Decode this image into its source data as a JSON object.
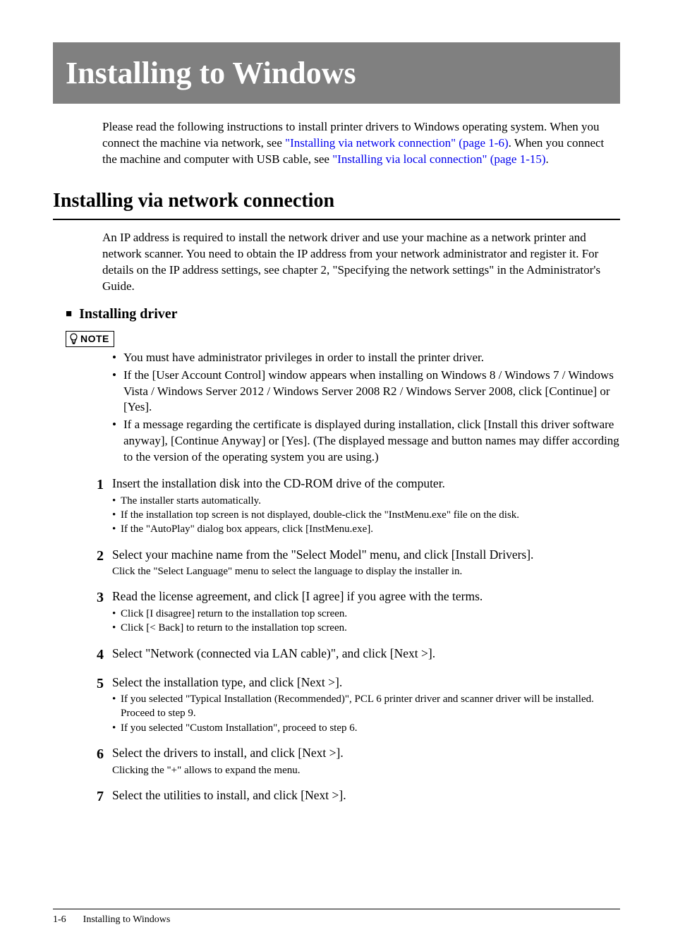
{
  "chapter": {
    "title": "Installing to Windows"
  },
  "intro": {
    "pre": "Please read the following instructions to install printer drivers to Windows operating system.  When you connect the machine via network, see ",
    "link1": "\"Installing via network connection\" (page 1-6)",
    "mid": ".  When you connect the machine and computer with USB cable, see ",
    "link2": "\"Installing via local connection\" (page 1-15)",
    "post": "."
  },
  "section": {
    "title": "Installing via network connection",
    "body": "An IP address is required to install the network driver and use your machine as a network printer and network scanner.  You need to obtain the IP address from your network administrator and register it.  For details on the IP address settings, see chapter 2, \"Specifying the network settings\" in the Administrator's Guide."
  },
  "subsection": {
    "bullet": "■",
    "title": "Installing driver"
  },
  "note": {
    "label": "NOTE",
    "items": [
      "You must have administrator privileges in order to install the printer driver.",
      "If the [User Account Control] window appears when installing on Windows 8 / Windows 7 / Windows Vista / Windows Server 2012 / Windows Server 2008 R2 / Windows Server 2008, click [Continue] or [Yes].",
      "If a message regarding the certificate is displayed during installation, click [Install this driver software anyway], [Continue Anyway] or [Yes]. (The displayed message and button names may differ according to the version of the operating system you are using.)"
    ]
  },
  "steps": [
    {
      "num": "1",
      "main": "Insert the installation disk into the CD-ROM drive of the computer.",
      "subs": [
        "The installer starts automatically.",
        "If the installation top screen is not displayed, double-click the \"InstMenu.exe\" file on the disk.",
        "If the \"AutoPlay\" dialog box appears, click [InstMenu.exe]."
      ]
    },
    {
      "num": "2",
      "main": "Select your machine name from the \"Select Model\" menu, and click [Install Drivers].",
      "plain_sub": "Click the \"Select Language\" menu to select the language to display the installer in."
    },
    {
      "num": "3",
      "main": "Read the license agreement, and click [I agree] if you agree with the terms.",
      "subs": [
        "Click [I disagree] return to the installation top screen.",
        "Click [< Back] to return to the installation top screen."
      ]
    },
    {
      "num": "4",
      "main": "Select \"Network (connected via LAN cable)\", and click [Next >]."
    },
    {
      "num": "5",
      "main": "Select the installation type, and click [Next >].",
      "subs": [
        "If you selected \"Typical Installation (Recommended)\", PCL 6 printer driver and scanner driver will be installed.  Proceed to step 9.",
        "If you selected \"Custom Installation\", proceed to step 6."
      ]
    },
    {
      "num": "6",
      "main": "Select the drivers to install, and click [Next >].",
      "plain_sub": "Clicking the \"+\" allows to expand the menu."
    },
    {
      "num": "7",
      "main": "Select the utilities to install, and click [Next >]."
    }
  ],
  "footer": {
    "page": "1-6",
    "title": "Installing to Windows"
  }
}
